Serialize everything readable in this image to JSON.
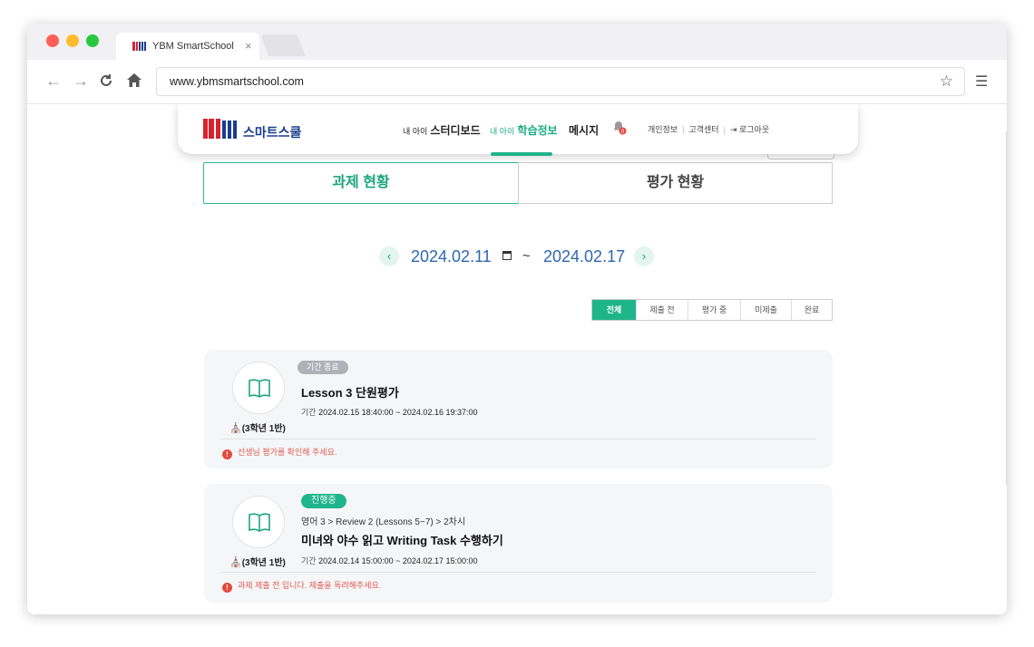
{
  "browser": {
    "tab_title": "YBM SmartSchool",
    "tab_close": "×",
    "url": "www.ybmsmartschool.com",
    "colors": {
      "close": "#ff5f57",
      "min": "#febc2e",
      "max": "#28c840"
    }
  },
  "header": {
    "brand_text": "스마트스쿨",
    "nav": [
      {
        "prefix": "내 아이",
        "label": "스터디보드",
        "active": false
      },
      {
        "prefix": "내 아이",
        "label": "학습정보",
        "active": true
      },
      {
        "prefix": "",
        "label": "메시지",
        "active": false
      }
    ],
    "notification_count": "0",
    "util": {
      "profile": "개인정보",
      "support": "고객센터",
      "logout": "로그아웃"
    }
  },
  "segments": {
    "assignments": "과제 현황",
    "evaluation": "평가 현황"
  },
  "date_range": {
    "start": "2024.02.11",
    "tilde": "~",
    "end": "2024.02.17",
    "prev": "‹",
    "next": "›"
  },
  "filters": [
    "전체",
    "제출 전",
    "평가 중",
    "미제출",
    "완료"
  ],
  "cards": [
    {
      "badge": "기간 종료",
      "title": "Lesson 3 단원평가",
      "period_label": "기간",
      "period": "2024.02.15 18:40:00 ~ 2024.02.16 19:37:00",
      "class": "(3학년 1반)",
      "warning": "선생님 평가를 확인해 주세요."
    },
    {
      "badge": "진행중",
      "crumbs": [
        "영어 3",
        "Review 2 (Lessons 5~7)",
        "2차시"
      ],
      "title": "미녀와 야수 읽고 Writing Task 수행하기",
      "period_label": "기간",
      "period": "2024.02.14 15:00:00 ~ 2024.02.17 15:00:00",
      "class": "(3학년 1반)",
      "warning": "과제 제출 전 입니다. 제출을 독려해주세요."
    }
  ],
  "accent_color": "#1fb58a"
}
